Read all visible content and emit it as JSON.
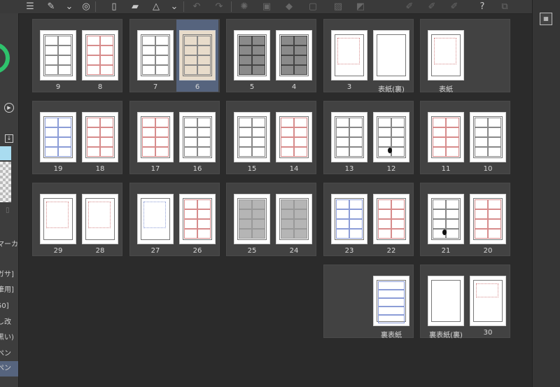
{
  "toolbar": {
    "icons": [
      "menu-icon",
      "brush-settings-icon",
      "chevron-down-icon",
      "spiral-icon",
      "new-page-icon",
      "open-folder-icon",
      "warning-save-icon",
      "chevron-down-icon",
      "undo-icon",
      "redo-icon",
      "sparkle-icon",
      "transform-icon",
      "fill-icon",
      "frame-icon",
      "slash-icon",
      "half-icon",
      "pen-icon",
      "pen-2-icon",
      "pen-3-icon",
      "help-icon",
      "preview-icon"
    ]
  },
  "left_panel": {
    "items": [
      "マーカ",
      "ガサ]",
      "筆用]",
      "50]",
      "し改",
      "黒い)",
      "ペン",
      "ペン"
    ]
  },
  "right_strip": {
    "icons": [
      "calendar-icon"
    ]
  },
  "spreads": [
    {
      "pages": [
        {
          "label": "9",
          "style": "comic"
        },
        {
          "label": "8",
          "style": "comic-red"
        }
      ]
    },
    {
      "pages": [
        {
          "label": "7",
          "style": "comic"
        },
        {
          "label": "6",
          "style": "comic-selected"
        }
      ],
      "selected_page": "6"
    },
    {
      "pages": [
        {
          "label": "5",
          "style": "comic-dark"
        },
        {
          "label": "4",
          "style": "comic-dark"
        }
      ]
    },
    {
      "pages": [
        {
          "label": "3",
          "style": "sketch"
        },
        {
          "label": "表紙(裏)",
          "style": "blank"
        }
      ]
    },
    {
      "pages": [
        {
          "label": "表紙",
          "style": "cover"
        }
      ]
    },
    {
      "pages": [
        {
          "label": "19",
          "style": "comic-blue"
        },
        {
          "label": "18",
          "style": "comic-red"
        }
      ]
    },
    {
      "pages": [
        {
          "label": "17",
          "style": "comic-red"
        },
        {
          "label": "16",
          "style": "comic"
        }
      ]
    },
    {
      "pages": [
        {
          "label": "15",
          "style": "comic"
        },
        {
          "label": "14",
          "style": "comic-red"
        }
      ]
    },
    {
      "pages": [
        {
          "label": "13",
          "style": "comic"
        },
        {
          "label": "12",
          "style": "comic-blob"
        }
      ]
    },
    {
      "pages": [
        {
          "label": "11",
          "style": "comic-red"
        },
        {
          "label": "10",
          "style": "comic"
        }
      ]
    },
    {
      "pages": [
        {
          "label": "29",
          "style": "sketch-red"
        },
        {
          "label": "28",
          "style": "sketch-red"
        }
      ]
    },
    {
      "pages": [
        {
          "label": "27",
          "style": "sketch-blue"
        },
        {
          "label": "26",
          "style": "comic-red"
        }
      ]
    },
    {
      "pages": [
        {
          "label": "25",
          "style": "comic-grey"
        },
        {
          "label": "24",
          "style": "comic-grey"
        }
      ]
    },
    {
      "pages": [
        {
          "label": "23",
          "style": "comic-blue"
        },
        {
          "label": "22",
          "style": "comic-red"
        }
      ]
    },
    {
      "pages": [
        {
          "label": "21",
          "style": "comic-blob"
        },
        {
          "label": "20",
          "style": "comic-red"
        }
      ]
    },
    {
      "pages": [
        {
          "label": "裏表紙",
          "style": "back-cover"
        }
      ]
    },
    {
      "pages": [
        {
          "label": "裏表紙(裏)",
          "style": "blank"
        },
        {
          "label": "30",
          "style": "handwriting"
        }
      ]
    }
  ]
}
